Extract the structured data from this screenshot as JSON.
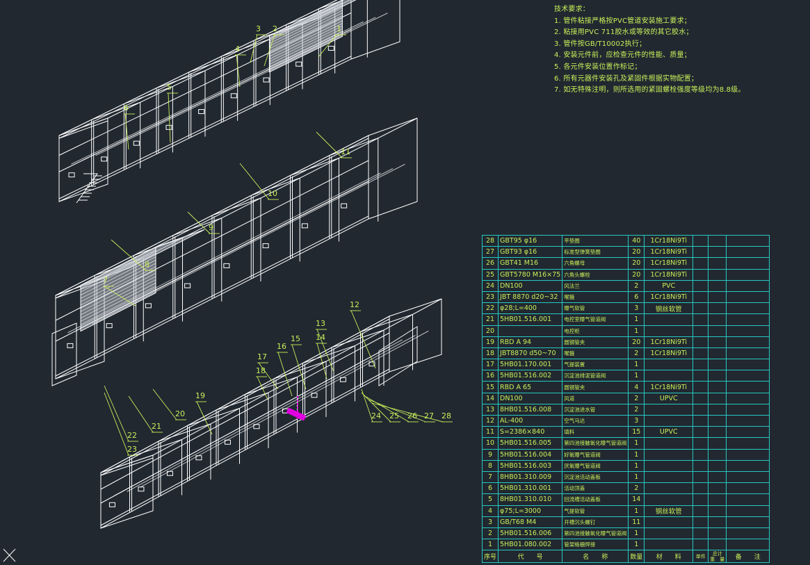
{
  "requirements": {
    "title": "技术要求：",
    "items": [
      "1. 管件粘接严格按PVC管道安装施工要求；",
      "2. 粘接用PVC 711胶水或等效的其它胶水；",
      "3. 管件按GB/T10002执行；",
      "4. 安装元件前，应检查元件的性能、质量；",
      "5. 各元件安装位置作标记；",
      "6. 所有元器件安装孔及紧固件根据实物配置；",
      "7. 如无特殊注明，则所选用的紧固螺栓强度等级均为8.8级。"
    ]
  },
  "callouts": [
    "1",
    "2",
    "3",
    "4",
    "5",
    "6",
    "7",
    "8",
    "9",
    "10",
    "11",
    "12",
    "13",
    "14",
    "15",
    "16",
    "17",
    "18",
    "19",
    "20",
    "21",
    "22",
    "23",
    "24",
    "25",
    "26",
    "27",
    "28"
  ],
  "bom": {
    "rows": [
      {
        "no": "28",
        "code": "GBT95 φ16",
        "name": "平垫圈",
        "qty": "40",
        "material": "1Cr18Ni9Ti"
      },
      {
        "no": "27",
        "code": "GBT93 φ16",
        "name": "标准型弹簧垫圈",
        "qty": "20",
        "material": "1Cr18Ni9Ti"
      },
      {
        "no": "26",
        "code": "GBT41 M16",
        "name": "六角螺母",
        "qty": "20",
        "material": "1Cr18Ni9Ti"
      },
      {
        "no": "25",
        "code": "GBT5780 M16×75",
        "name": "六角头螺栓",
        "qty": "20",
        "material": "1Cr18Ni9Ti"
      },
      {
        "no": "24",
        "code": "DN100",
        "name": "风法兰",
        "qty": "2",
        "material": "PVC"
      },
      {
        "no": "23",
        "code": "JBT 8870 d20~32",
        "name": "喉箍",
        "qty": "6",
        "material": "1Cr18Ni9Ti"
      },
      {
        "no": "22",
        "code": "φ28;L=400",
        "name": "曝气软管",
        "qty": "3",
        "material": "钢丝软管"
      },
      {
        "no": "21",
        "code": "5HB01.516.001",
        "name": "电控室曝气管道阀",
        "qty": "1",
        "material": ""
      },
      {
        "no": "20",
        "code": "",
        "name": "电控柜",
        "qty": "1",
        "material": ""
      },
      {
        "no": "19",
        "code": "RBD A 94",
        "name": "圆钢管夹",
        "qty": "20",
        "material": "1Cr18Ni9Ti"
      },
      {
        "no": "18",
        "code": "JBT8870 d50~70",
        "name": "喉箍",
        "qty": "2",
        "material": "1Cr18Ni9Ti"
      },
      {
        "no": "17",
        "code": "5HB01.170.001",
        "name": "气提装置",
        "qty": "1",
        "material": ""
      },
      {
        "no": "16",
        "code": "5HB01.516.002",
        "name": "沉淀池排泥管道阀",
        "qty": "1",
        "material": ""
      },
      {
        "no": "15",
        "code": "RBD A 65",
        "name": "圆钢管夹",
        "qty": "4",
        "material": "1Cr18Ni9Ti"
      },
      {
        "no": "14",
        "code": "DN100",
        "name": "风道",
        "qty": "2",
        "material": "UPVC"
      },
      {
        "no": "13",
        "code": "8HB01.516.008",
        "name": "沉淀池进水管",
        "qty": "2",
        "material": ""
      },
      {
        "no": "12",
        "code": "AL-400",
        "name": "空气马达",
        "qty": "3",
        "material": ""
      },
      {
        "no": "11",
        "code": "S=2386×840",
        "name": "填料",
        "qty": "15",
        "material": "UPVC"
      },
      {
        "no": "10",
        "code": "5HB01.516.005",
        "name": "第四池接触氧化曝气管道阀",
        "qty": "1",
        "material": ""
      },
      {
        "no": "9",
        "code": "5HB01.516.004",
        "name": "好氧曝气管道阀",
        "qty": "1",
        "material": ""
      },
      {
        "no": "8",
        "code": "5HB01.516.003",
        "name": "厌氧曝气管道阀",
        "qty": "1",
        "material": ""
      },
      {
        "no": "7",
        "code": "8HB01.310.009",
        "name": "沉淀池活动盖板",
        "qty": "1",
        "material": ""
      },
      {
        "no": "6",
        "code": "5HB01.310.001",
        "name": "活动顶盖",
        "qty": "2",
        "material": ""
      },
      {
        "no": "5",
        "code": "8HB01.310.010",
        "name": "回流槽活动盖板",
        "qty": "14",
        "material": ""
      },
      {
        "no": "4",
        "code": "φ75;L=3000",
        "name": "气提软管",
        "qty": "1",
        "material": "钢丝软管"
      },
      {
        "no": "3",
        "code": "GB/T68 M4",
        "name": "开槽沉头螺钉",
        "qty": "11",
        "material": ""
      },
      {
        "no": "2",
        "code": "5HB01.516.006",
        "name": "第四池接触氧化曝气管道阀",
        "qty": "1",
        "material": ""
      },
      {
        "no": "1",
        "code": "5HB01.080.002",
        "name": "管架格栅焊接",
        "qty": "1",
        "material": ""
      }
    ],
    "header": {
      "no": "序号",
      "code": "代　　号",
      "name": "名　　称",
      "qty": "数量",
      "material": "材　　料",
      "unit": "单件",
      "total": "总计",
      "remark": "备　　注",
      "weight": "重　量"
    }
  },
  "colors": {
    "background": "#212830",
    "linework": "#ffffff",
    "callout": "#c8f05a",
    "table_border": "#27c9c2",
    "highlight": "#e000e0"
  }
}
